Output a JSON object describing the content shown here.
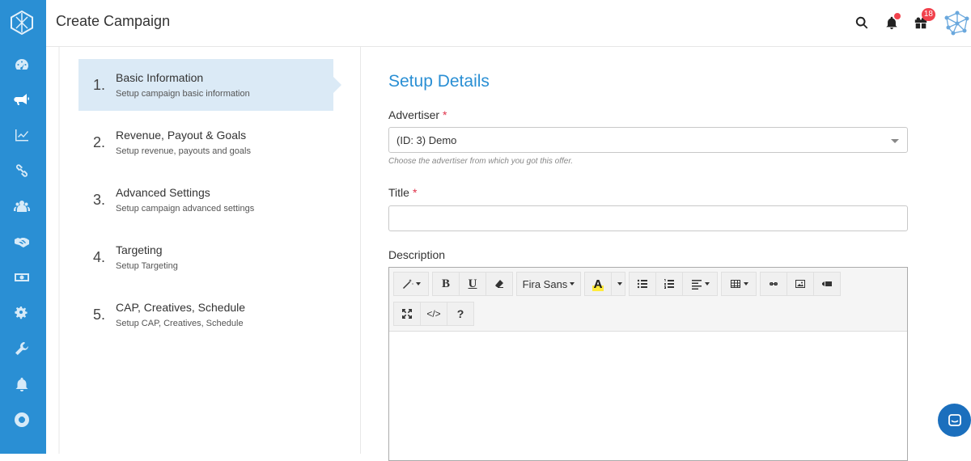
{
  "header": {
    "title": "Create Campaign",
    "notifications_badge": "18"
  },
  "sidebar": {
    "items": [
      {
        "icon": "dashboard-icon"
      },
      {
        "icon": "megaphone-icon",
        "active": true
      },
      {
        "icon": "chart-line-icon"
      },
      {
        "icon": "link-icon"
      },
      {
        "icon": "users-icon"
      },
      {
        "icon": "handshake-icon"
      },
      {
        "icon": "money-icon"
      },
      {
        "icon": "cogs-icon"
      },
      {
        "icon": "wrench-icon"
      },
      {
        "icon": "bell-icon"
      },
      {
        "icon": "lifebuoy-icon"
      }
    ]
  },
  "steps": [
    {
      "num": "1.",
      "title": "Basic Information",
      "sub": "Setup campaign basic information"
    },
    {
      "num": "2.",
      "title": "Revenue, Payout & Goals",
      "sub": "Setup revenue, payouts and goals"
    },
    {
      "num": "3.",
      "title": "Advanced Settings",
      "sub": "Setup campaign advanced settings"
    },
    {
      "num": "4.",
      "title": "Targeting",
      "sub": "Setup Targeting"
    },
    {
      "num": "5.",
      "title": "CAP, Creatives, Schedule",
      "sub": "Setup CAP, Creatives, Schedule"
    }
  ],
  "form": {
    "section_title": "Setup Details",
    "advertiser_label": "Advertiser",
    "required_mark": "*",
    "advertiser_value": "(ID: 3) Demo",
    "advertiser_hint": "Choose the advertiser from which you got this offer.",
    "title_label": "Title",
    "title_value": "",
    "description_label": "Description"
  },
  "editor": {
    "font_name": "Fira Sans",
    "color_letter": "A",
    "code_label": "</>",
    "help_label": "?",
    "bold_label": "B",
    "underline_label": "U"
  },
  "colors": {
    "sidebar": "#2a8fd4",
    "accent": "#2a8fd4",
    "active_step": "#dbeaf6",
    "required": "#e0334a",
    "badge": "#f1424d"
  }
}
